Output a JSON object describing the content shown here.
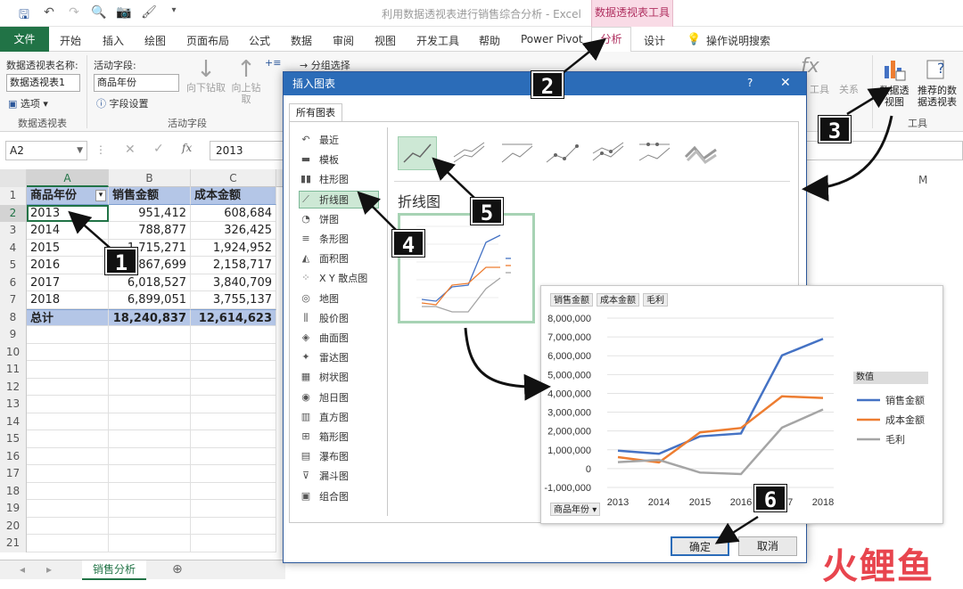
{
  "window": {
    "title": "利用数据透视表进行销售综合分析 - Excel",
    "context_tab_group": "数据透视表工具"
  },
  "ribbon_tabs": {
    "file": "文件",
    "items": [
      "开始",
      "插入",
      "绘图",
      "页面布局",
      "公式",
      "数据",
      "审阅",
      "视图",
      "开发工具",
      "帮助",
      "Power Pivot"
    ],
    "analyze": "分析",
    "design": "设计",
    "tell_me": "操作说明搜索"
  },
  "ribbon": {
    "pivot_name_label": "数据透视表名称:",
    "pivot_name_value": "数据透视表1",
    "options": "选项",
    "group_pivot": "数据透视表",
    "active_field_label": "活动字段:",
    "active_field_value": "商品年份",
    "field_settings": "字段设置",
    "drill_down": "向下钻取",
    "drill_up": "向上钻取",
    "group_active": "活动字段",
    "group_selection": "分组选择",
    "tools_label": "工具",
    "relations": "关系",
    "pivot_chart": "数据透视图",
    "recommended": "推荐的数据透视表",
    "group_tools": "工具"
  },
  "formula_bar": {
    "name_box": "A2",
    "value": "2013"
  },
  "sheet": {
    "columns": [
      "A",
      "B",
      "C"
    ],
    "col_right": "M",
    "row_numbers": [
      "1",
      "2",
      "3",
      "4",
      "5",
      "6",
      "7",
      "8",
      "9",
      "10",
      "11",
      "12",
      "13",
      "14",
      "15",
      "16",
      "17",
      "18",
      "19",
      "20",
      "21"
    ],
    "header": [
      "商品年份",
      "销售金额",
      "成本金额"
    ],
    "rows": [
      [
        "2013",
        "951,412",
        "608,684"
      ],
      [
        "2014",
        "788,877",
        "326,425"
      ],
      [
        "2015",
        "1,715,271",
        "1,924,952"
      ],
      [
        "2016",
        "1,867,699",
        "2,158,717"
      ],
      [
        "2017",
        "6,018,527",
        "3,840,709"
      ],
      [
        "2018",
        "6,899,051",
        "3,755,137"
      ]
    ],
    "total": [
      "总计",
      "18,240,837",
      "12,614,623"
    ],
    "tab": "销售分析"
  },
  "dialog": {
    "title": "插入图表",
    "help": "?",
    "close": "✕",
    "tab": "所有图表",
    "chart_types": [
      "最近",
      "模板",
      "柱形图",
      "折线图",
      "饼图",
      "条形图",
      "面积图",
      "X Y 散点图",
      "地图",
      "股价图",
      "曲面图",
      "雷达图",
      "树状图",
      "旭日图",
      "直方图",
      "箱形图",
      "瀑布图",
      "漏斗图",
      "组合图"
    ],
    "selected_type": "折线图",
    "subtype_title": "折线图",
    "ok": "确定",
    "cancel": "取消"
  },
  "chart_fields": [
    "销售金额",
    "成本金额",
    "毛利"
  ],
  "axis_field": "商品年份",
  "legend_title": "数值",
  "chart_data": {
    "type": "line",
    "categories": [
      "2013",
      "2014",
      "2015",
      "2016",
      "2017",
      "2018"
    ],
    "series": [
      {
        "name": "销售金额",
        "color": "#4472c4",
        "values": [
          951412,
          788877,
          1715271,
          1867699,
          6018527,
          6899051
        ]
      },
      {
        "name": "成本金额",
        "color": "#ed7d31",
        "values": [
          608684,
          326425,
          1924952,
          2158717,
          3840709,
          3755137
        ]
      },
      {
        "name": "毛利",
        "color": "#a5a5a5",
        "values": [
          342728,
          462452,
          -209681,
          -291018,
          2177818,
          3143914
        ]
      }
    ],
    "yticks": [
      "8,000,000",
      "7,000,000",
      "6,000,000",
      "5,000,000",
      "4,000,000",
      "3,000,000",
      "2,000,000",
      "1,000,000",
      "0",
      "-1,000,000"
    ],
    "ylim": [
      -1000000,
      8000000
    ],
    "legend": "right",
    "grid": true
  },
  "steps": [
    "1",
    "2",
    "3",
    "4",
    "5",
    "6"
  ],
  "watermark": "火鲤鱼"
}
